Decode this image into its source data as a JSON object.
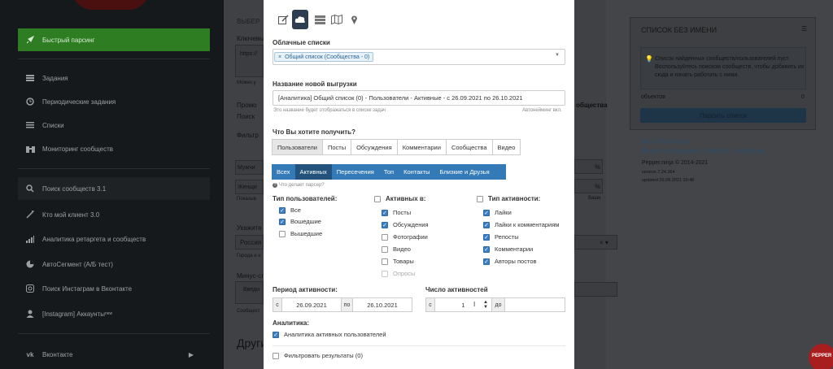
{
  "sidebar": {
    "quick_parse": "Быстрый парсинг",
    "items": [
      {
        "label": "Задания",
        "icon": "tasks-icon"
      },
      {
        "label": "Периодические задания",
        "icon": "clock-icon"
      },
      {
        "label": "Списки",
        "icon": "list-icon"
      },
      {
        "label": "Мониторинг сообществ",
        "icon": "binoculars-icon"
      }
    ],
    "items2": [
      {
        "label": "Поиск сообществ 3.1",
        "icon": "search-icon"
      },
      {
        "label": "Кто мой клиент 3.0",
        "icon": "wand-icon"
      },
      {
        "label": "Аналитика ретаргета и сообществ",
        "icon": "bar-chart-icon"
      },
      {
        "label": "АвтоСегмент (А/Б тест)",
        "icon": "pie-chart-icon"
      },
      {
        "label": "Поиск Инстаграм в Вконтакте",
        "icon": "instagram-icon"
      },
      {
        "label": "[Instagram] Аккаунты",
        "sup": "new",
        "icon": "user-icon"
      }
    ],
    "vk": "Вконтакте"
  },
  "background": {
    "heading": "ВЫБЕР",
    "keywords": "Ключевы",
    "url_hint": "https://",
    "can_hint": "Можно у",
    "promo": "Промо",
    "search": "Поиск",
    "filters": "Фильтр",
    "male": "Мужчи",
    "female": "Женщи",
    "show": "Показыв",
    "specify": "Укажите",
    "russia": "Россия",
    "cities": "Города и н",
    "minus": "Минус-сл",
    "enter": "Введи",
    "comm": "Сообщест",
    "others": "Други",
    "communities": "общества",
    "your": "Ваши",
    "percent": "%"
  },
  "right_panel": {
    "title": "СПИСОК БЕЗ ИМЕНИ",
    "info": "Список найденных сообществ/пользователей пуст. Воспользуйтесь поиском сообществ, чтобы добавить их сюда и начать работать с ними.",
    "objects": "объектов",
    "count": "0",
    "parse_button": "Парсить список",
    "vk_link": "Мы в Вконтакте",
    "video_link": "Видео инструкции по работе с сервисом",
    "copyright": "Pepper.ninja © 2014-2021",
    "version": "version 7.24.364",
    "updated": "updated 26.09.2021 19:48"
  },
  "modal": {
    "toolbar": [
      "edit-icon",
      "cloud-icon",
      "server-icon",
      "map-icon",
      "pin-icon"
    ],
    "cloud_lists_label": "Облачные списки",
    "cloud_tag": "Общий список (Сообщества - 0)",
    "tag_remove": "×",
    "new_export_label": "Название новой выгрузки",
    "export_name": "[Аналитика] Общий список (0) - Пользователи - Активные - с 26.09.2021 по 26.10.2021",
    "name_hint": "Это название будет отображаться в списке задач",
    "autoname": "Автонейминг вкл.",
    "want_label": "Что Вы хотите получить?",
    "tabs": [
      "Пользователи",
      "Посты",
      "Обсуждения",
      "Комментарии",
      "Сообщества",
      "Видео"
    ],
    "subtabs": [
      "Всех",
      "Активных",
      "Пересечения",
      "Топ",
      "Контакты",
      "Близкие и Друзья"
    ],
    "parser_help": "Что делает парсер?",
    "user_type_label": "Тип пользователей:",
    "user_types": [
      {
        "label": "Все",
        "checked": true
      },
      {
        "label": "Вошедшие",
        "checked": true
      },
      {
        "label": "Вышедшие",
        "checked": false
      }
    ],
    "active_in_label": "Активных в:",
    "active_in": [
      {
        "label": "Посты",
        "checked": true
      },
      {
        "label": "Обсуждения",
        "checked": true
      },
      {
        "label": "Фотографии",
        "checked": false
      },
      {
        "label": "Видео",
        "checked": false
      },
      {
        "label": "Товары",
        "checked": false
      },
      {
        "label": "Опросы",
        "checked": false,
        "disabled": true
      }
    ],
    "activity_type_label": "Тип активности:",
    "activity_types": [
      {
        "label": "Лайки",
        "checked": true
      },
      {
        "label": "Лайки к комментариям",
        "checked": true
      },
      {
        "label": "Репосты",
        "checked": true
      },
      {
        "label": "Комментарии",
        "checked": true
      },
      {
        "label": "Авторы постов",
        "checked": true
      }
    ],
    "period_label": "Период активности:",
    "from": "с",
    "to": "по",
    "date_from": "26.09.2021",
    "date_to": "26.10.2021",
    "count_label": "Число активностей",
    "count_from": "с",
    "count_value": "1",
    "count_to": "до",
    "analytics_label": "Аналитика:",
    "analytics_option": "Аналитика активных пользователей",
    "filter_option": "Фильтровать результаты (0)"
  }
}
